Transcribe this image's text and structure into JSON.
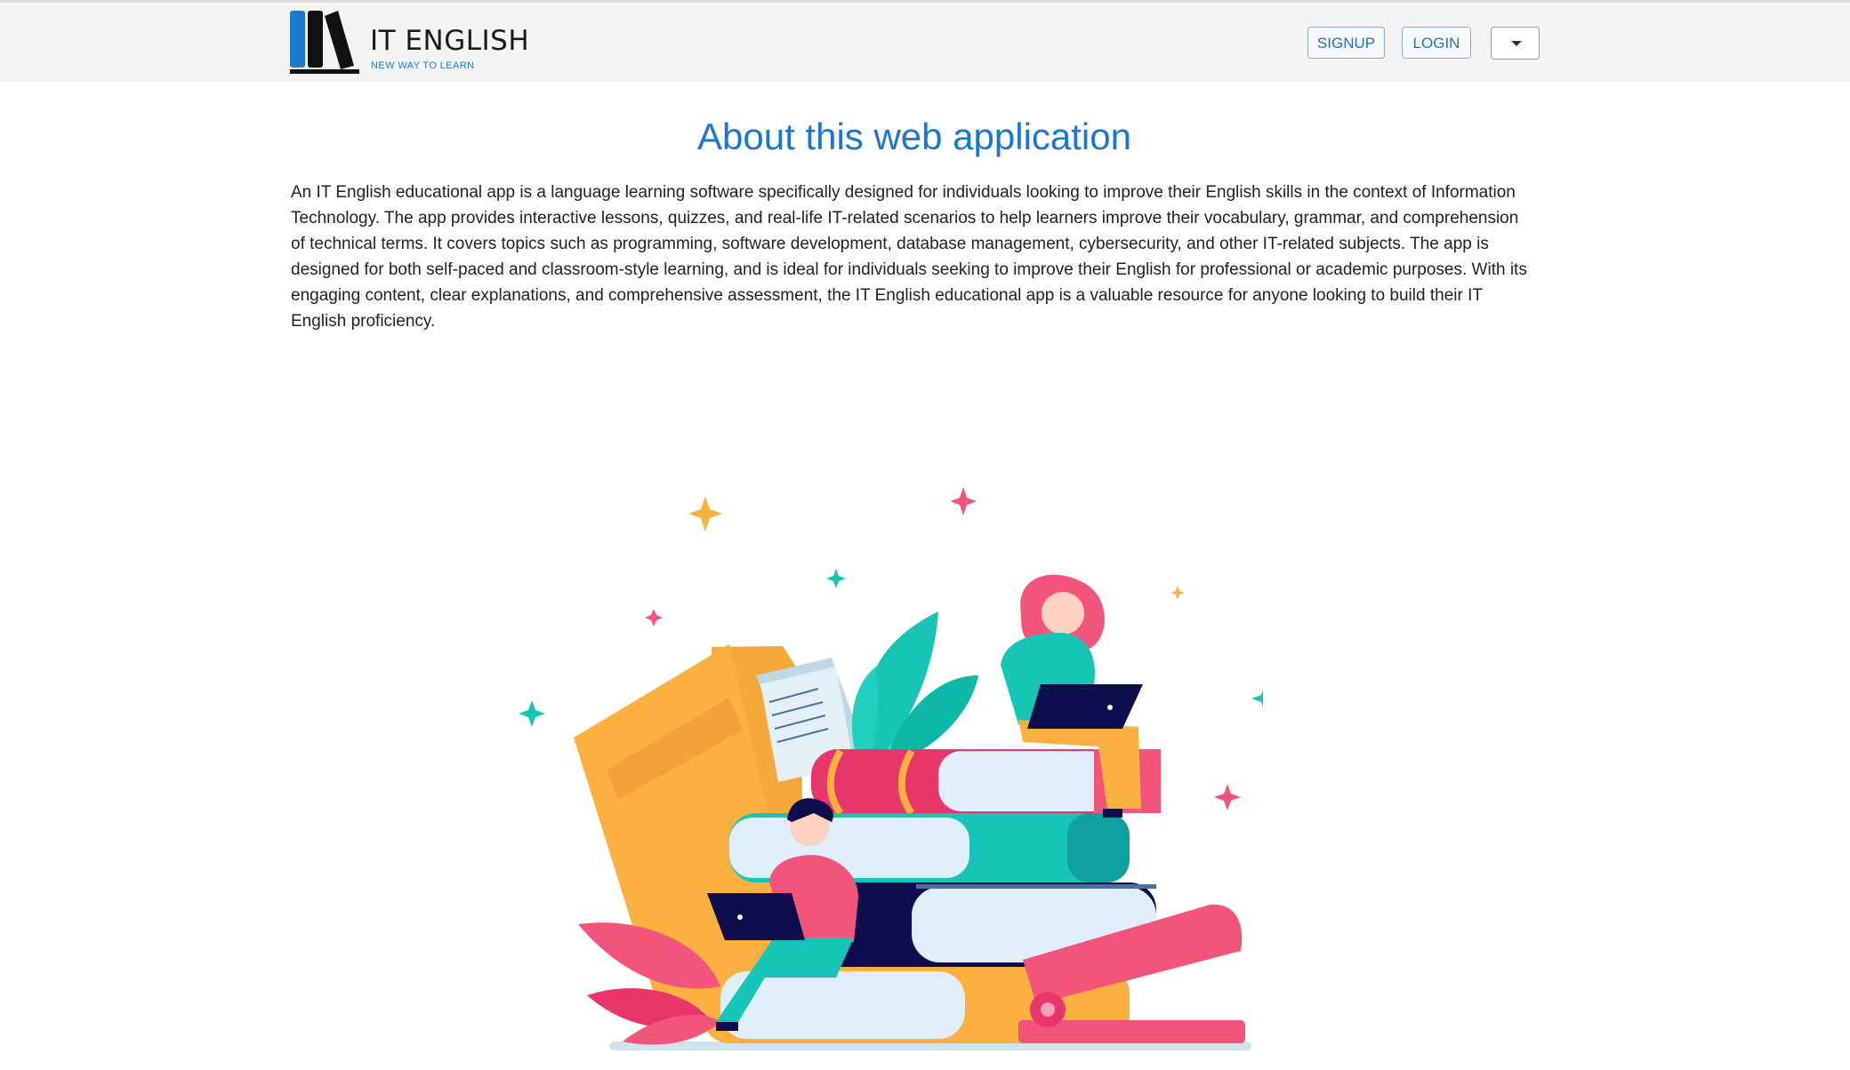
{
  "brand": {
    "title": "IT ENGLISH",
    "tagline": "NEW WAY TO LEARN"
  },
  "navbar": {
    "signup_label": "SIGNUP",
    "login_label": "LOGIN",
    "menu_icon": "caret-down-icon"
  },
  "about": {
    "title": "About this web application",
    "description": "An IT English educational app is a language learning software specifically designed for individuals looking to improve their English skills in the context of Information Technology. The app provides interactive lessons, quizzes, and real-life IT-related scenarios to help learners improve their vocabulary, grammar, and comprehension of technical terms. It covers topics such as programming, software development, database management, cybersecurity, and other IT-related subjects. The app is designed for both self-paced and classroom-style learning, and is ideal for individuals seeking to improve their English for professional or academic purposes. With its engaging content, clear explanations, and comprehensive assessment, the IT English educational app is a valuable resource for anyone looking to build their IT English proficiency."
  },
  "colors": {
    "accent": "#1976d2",
    "navbar_bg": "#f4f4f4",
    "book_yellow": "#fbb040",
    "book_teal": "#16c5b5",
    "book_pink": "#f2547a",
    "navy": "#0d0d4e"
  }
}
